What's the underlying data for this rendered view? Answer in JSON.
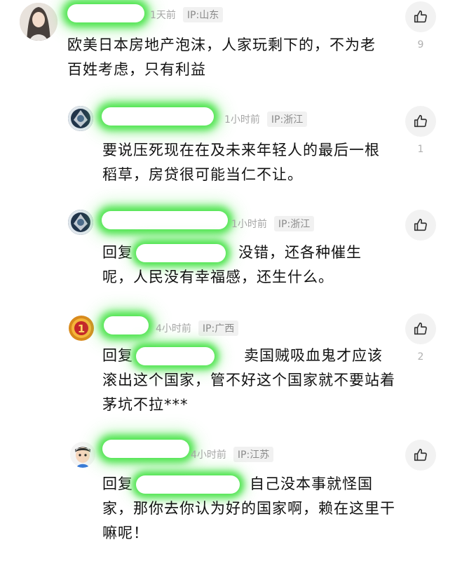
{
  "comments": [
    {
      "time": "1天前",
      "ip": "IP:山东",
      "text": "欧美日本房地产泡沫，人家玩剩下的，不为老百姓考虑，只有利益",
      "likes": "9"
    },
    {
      "time": "1小时前",
      "ip": "IP:浙江",
      "text": "要说压死现在在及未来年轻人的最后一根稻草，房贷很可能当仁不让。",
      "likes": "1"
    },
    {
      "time": "1小时前",
      "ip": "IP:浙江",
      "reply_prefix": "回复",
      "text_line1": "没错，还各种催生",
      "text_rest": "呢，人民没有幸福感，还生什么。",
      "likes": ""
    },
    {
      "time": "4小时前",
      "ip": "IP:广西",
      "reply_prefix": "回复",
      "text_line1": "卖国贼吸血鬼才应该",
      "text_rest": "滚出这个国家，管不好这个国家就不要站着茅坑不拉***",
      "likes": "2"
    },
    {
      "time": "4小时前",
      "ip": "IP:江苏",
      "reply_prefix": "回复",
      "text_line1": "自己没本事就怪国",
      "text_rest": "家，那你去你认为好的国家啊，赖在这里干嘛呢！",
      "likes": ""
    }
  ],
  "icons": {
    "like": "thumbs-up-icon"
  }
}
